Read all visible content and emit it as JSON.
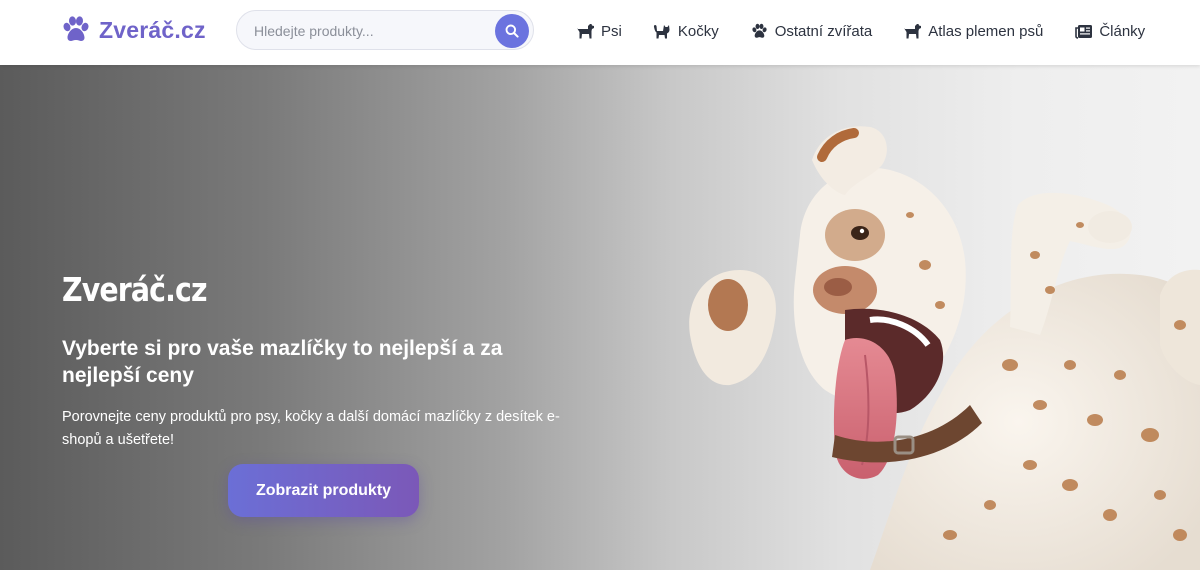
{
  "brand": {
    "name": "Zveráč.cz",
    "color": "#6f63c9"
  },
  "search": {
    "placeholder": "Hledejte produkty...",
    "value": "",
    "button_icon": "search-icon",
    "button_color": "#6b73df"
  },
  "nav": {
    "items": [
      {
        "label": "Psi",
        "icon": "dog-icon"
      },
      {
        "label": "Kočky",
        "icon": "cat-icon"
      },
      {
        "label": "Ostatní zvířata",
        "icon": "paw-icon"
      },
      {
        "label": "Atlas plemen psů",
        "icon": "dog-icon"
      },
      {
        "label": "Články",
        "icon": "newspaper-icon"
      }
    ]
  },
  "hero": {
    "title": "Zveráč.cz",
    "subtitle": "Vyberte si pro vaše mazlíčky to nejlepší a za nejlepší ceny",
    "description": "Porovnejte ceny produktů pro psy, kočky a další domácí mazlíčky z desítek e-shopů a ušetřete!",
    "cta_label": "Zobrazit produkty",
    "cta_gradient": [
      "#6b6fd6",
      "#7b58b8"
    ],
    "image": "dalmatian-dog-photo"
  }
}
